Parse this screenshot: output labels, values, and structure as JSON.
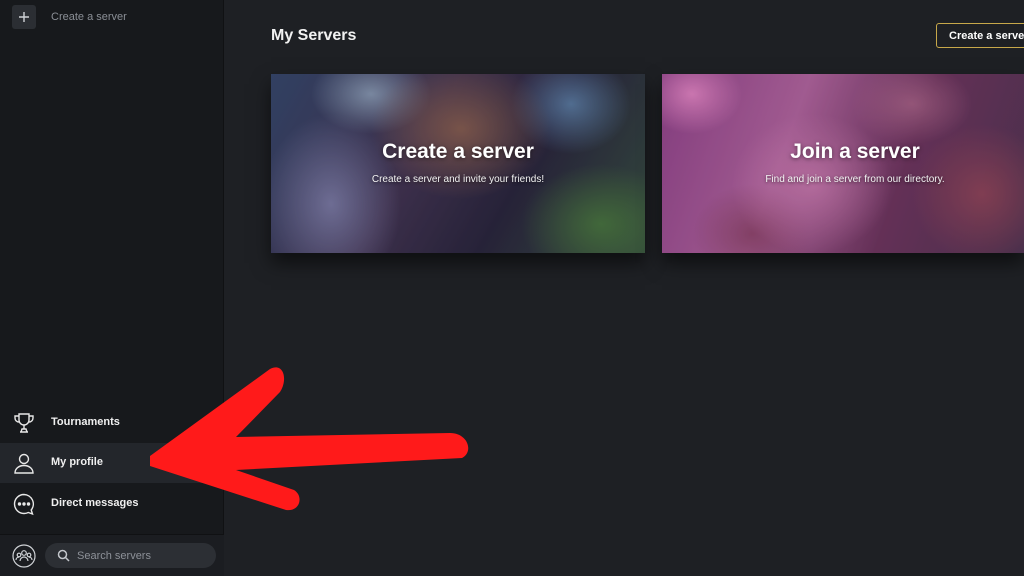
{
  "sidebar": {
    "create_label": "Create a server",
    "items": [
      {
        "label": "Tournaments",
        "icon": "trophy-icon"
      },
      {
        "label": "My profile",
        "icon": "user-icon"
      },
      {
        "label": "Direct messages",
        "icon": "chat-icon"
      }
    ],
    "search": {
      "placeholder": "Search servers"
    }
  },
  "main": {
    "title": "My Servers",
    "create_button": "Create a server",
    "cards": [
      {
        "title": "Create a server",
        "subtitle": "Create a server and invite your friends!"
      },
      {
        "title": "Join a server",
        "subtitle": "Find and join a server from our directory."
      }
    ]
  },
  "colors": {
    "sidebar_bg": "#17191c",
    "main_bg": "#1e2024",
    "accent_border": "#c7a84a",
    "annotation_arrow": "#ff1a1a"
  }
}
